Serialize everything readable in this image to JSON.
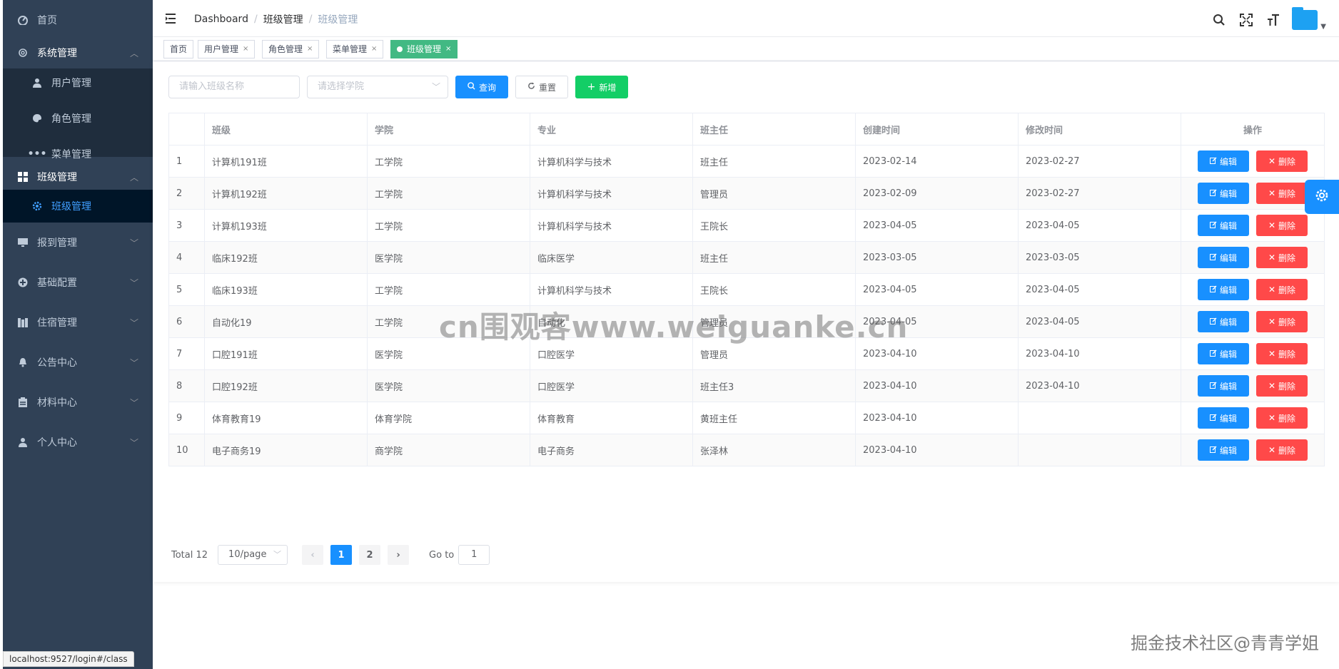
{
  "sidebar": {
    "items": [
      {
        "label": "首页",
        "icon": "dashboard-icon"
      },
      {
        "label": "系统管理",
        "icon": "gear-icon"
      },
      {
        "label": "用户管理",
        "icon": "user-icon"
      },
      {
        "label": "角色管理",
        "icon": "palette-icon"
      },
      {
        "label": "菜单管理",
        "icon": "more-icon"
      },
      {
        "label": "班级管理",
        "icon": "grid-icon"
      },
      {
        "label": "班级管理",
        "icon": "gear-icon"
      },
      {
        "label": "报到管理",
        "icon": "monitor-icon"
      },
      {
        "label": "基础配置",
        "icon": "plus-circle-icon"
      },
      {
        "label": "住宿管理",
        "icon": "building-icon"
      },
      {
        "label": "公告中心",
        "icon": "bell-icon"
      },
      {
        "label": "材料中心",
        "icon": "clipboard-icon"
      },
      {
        "label": "个人中心",
        "icon": "user-icon"
      }
    ]
  },
  "breadcrumb": {
    "home": "Dashboard",
    "parent": "班级管理",
    "current": "班级管理",
    "sep": "/"
  },
  "tags": [
    "首页",
    "用户管理",
    "角色管理",
    "菜单管理",
    "班级管理"
  ],
  "filters": {
    "name_placeholder": "请输入班级名称",
    "college_placeholder": "请选择学院",
    "search_label": "查询",
    "reset_label": "重置",
    "add_label": "新增"
  },
  "table": {
    "columns": [
      "",
      "班级",
      "学院",
      "专业",
      "班主任",
      "创建时间",
      "修改时间",
      "操作"
    ],
    "edit_label": "编辑",
    "delete_label": "删除",
    "rows": [
      [
        "1",
        "计算机191班",
        "工学院",
        "计算机科学与技术",
        "班主任",
        "2023-02-14",
        "2023-02-27"
      ],
      [
        "2",
        "计算机192班",
        "工学院",
        "计算机科学与技术",
        "管理员",
        "2023-02-09",
        "2023-02-27"
      ],
      [
        "3",
        "计算机193班",
        "工学院",
        "计算机科学与技术",
        "王院长",
        "2023-04-05",
        "2023-04-05"
      ],
      [
        "4",
        "临床192班",
        "医学院",
        "临床医学",
        "班主任",
        "2023-03-05",
        "2023-03-05"
      ],
      [
        "5",
        "临床193班",
        "工学院",
        "计算机科学与技术",
        "王院长",
        "2023-04-05",
        "2023-04-05"
      ],
      [
        "6",
        "自动化19",
        "工学院",
        "自动化",
        "管理员",
        "2023-04-05",
        "2023-04-05"
      ],
      [
        "7",
        "口腔191班",
        "医学院",
        "口腔医学",
        "管理员",
        "2023-04-10",
        "2023-04-10"
      ],
      [
        "8",
        "口腔192班",
        "医学院",
        "口腔医学",
        "班主任3",
        "2023-04-10",
        "2023-04-10"
      ],
      [
        "9",
        "体育教育19",
        "体育学院",
        "体育教育",
        "黄班主任",
        "2023-04-10",
        ""
      ],
      [
        "10",
        "电子商务19",
        "商学院",
        "电子商务",
        "张泽林",
        "2023-04-10",
        ""
      ]
    ]
  },
  "pagination": {
    "total": "Total 12",
    "page_size": "10/page",
    "pages": [
      "1",
      "2"
    ],
    "current_page": "1",
    "goto_label": "Go to",
    "goto_value": "1"
  },
  "watermark": {
    "center": "cn围观客www.weiguanke.cn",
    "bottom": "掘金技术社区@青青学姐"
  },
  "status_bar": "localhost:9527/login#/class",
  "colors": {
    "sidebar_bg": "#304156",
    "submenu_bg": "#1f2d3d",
    "primary": "#1890ff",
    "success": "#13ce66",
    "danger": "#ff4949",
    "tag_active": "#42b983"
  }
}
